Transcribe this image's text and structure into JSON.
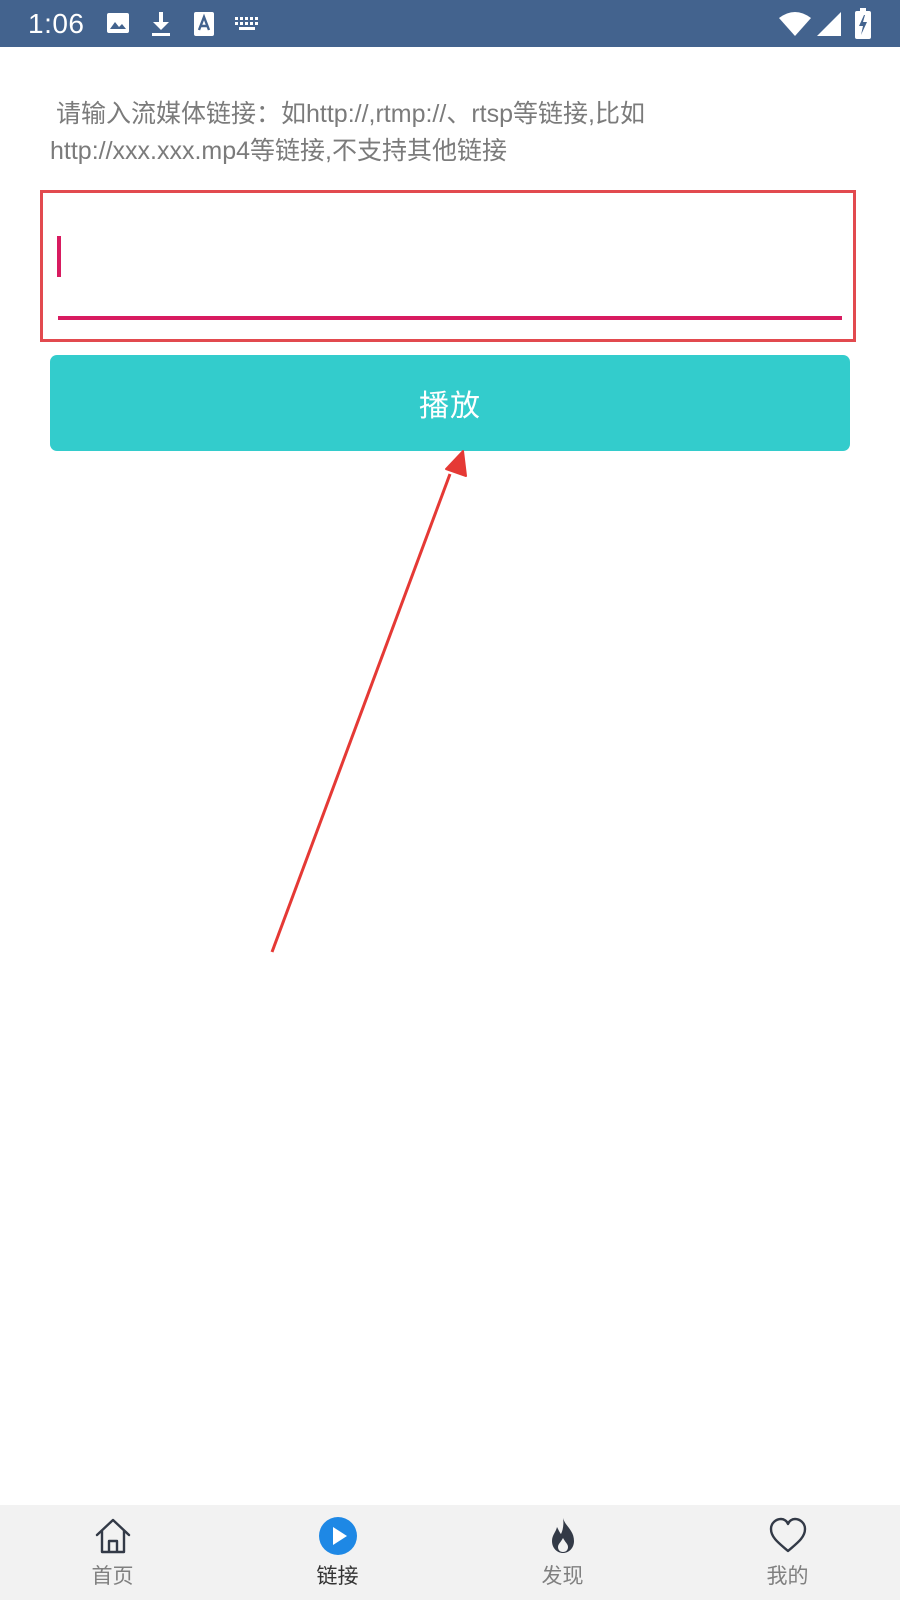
{
  "status_bar": {
    "time": "1:06",
    "notification_icons": [
      "image-icon",
      "download-icon",
      "font-a-icon",
      "keyboard-icon"
    ],
    "system_icons": [
      "wifi-icon",
      "signal-icon",
      "battery-charging-icon"
    ]
  },
  "hint": {
    "line1": "请输入流媒体链接：如http://,rtmp://、rtsp等链接,比如",
    "line2": "http://xxx.xxx.mp4等链接,不支持其他链接"
  },
  "url_input": {
    "value": "",
    "placeholder": ""
  },
  "play_button": {
    "label": "播放"
  },
  "bottom_nav": {
    "items": [
      {
        "label": "首页",
        "icon": "home-icon",
        "active": false
      },
      {
        "label": "链接",
        "icon": "play-circle-icon",
        "active": true
      },
      {
        "label": "发现",
        "icon": "flame-icon",
        "active": false
      },
      {
        "label": "我的",
        "icon": "heart-icon",
        "active": false
      }
    ]
  },
  "colors": {
    "status_bar": "#43638e",
    "accent": "#d81b60",
    "button": "#33cccc",
    "highlight_box": "#e24a4f",
    "nav_active_icon": "#1e88e5",
    "nav_background": "#f2f2f2"
  }
}
